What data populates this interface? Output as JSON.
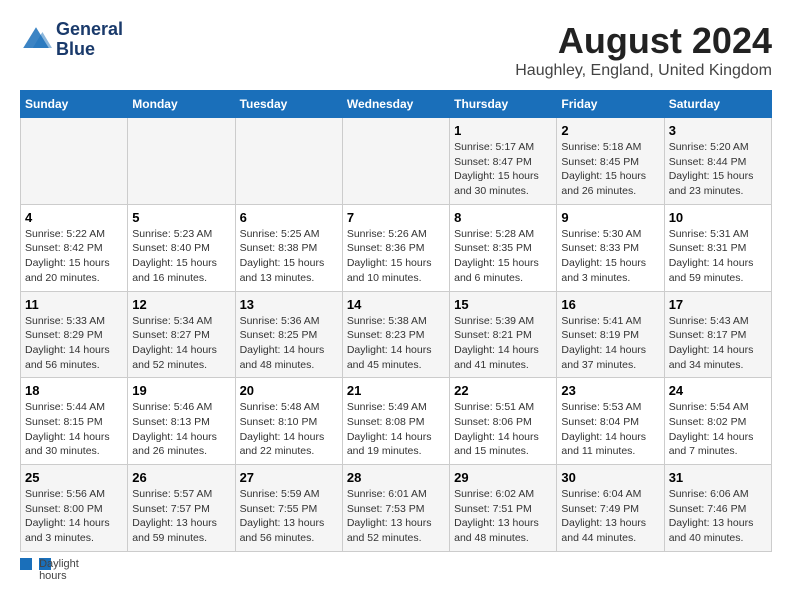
{
  "header": {
    "logo_line1": "General",
    "logo_line2": "Blue",
    "main_title": "August 2024",
    "subtitle": "Haughley, England, United Kingdom"
  },
  "days_of_week": [
    "Sunday",
    "Monday",
    "Tuesday",
    "Wednesday",
    "Thursday",
    "Friday",
    "Saturday"
  ],
  "weeks": [
    [
      {
        "day": "",
        "info": ""
      },
      {
        "day": "",
        "info": ""
      },
      {
        "day": "",
        "info": ""
      },
      {
        "day": "",
        "info": ""
      },
      {
        "day": "1",
        "info": "Sunrise: 5:17 AM\nSunset: 8:47 PM\nDaylight: 15 hours\nand 30 minutes."
      },
      {
        "day": "2",
        "info": "Sunrise: 5:18 AM\nSunset: 8:45 PM\nDaylight: 15 hours\nand 26 minutes."
      },
      {
        "day": "3",
        "info": "Sunrise: 5:20 AM\nSunset: 8:44 PM\nDaylight: 15 hours\nand 23 minutes."
      }
    ],
    [
      {
        "day": "4",
        "info": "Sunrise: 5:22 AM\nSunset: 8:42 PM\nDaylight: 15 hours\nand 20 minutes."
      },
      {
        "day": "5",
        "info": "Sunrise: 5:23 AM\nSunset: 8:40 PM\nDaylight: 15 hours\nand 16 minutes."
      },
      {
        "day": "6",
        "info": "Sunrise: 5:25 AM\nSunset: 8:38 PM\nDaylight: 15 hours\nand 13 minutes."
      },
      {
        "day": "7",
        "info": "Sunrise: 5:26 AM\nSunset: 8:36 PM\nDaylight: 15 hours\nand 10 minutes."
      },
      {
        "day": "8",
        "info": "Sunrise: 5:28 AM\nSunset: 8:35 PM\nDaylight: 15 hours\nand 6 minutes."
      },
      {
        "day": "9",
        "info": "Sunrise: 5:30 AM\nSunset: 8:33 PM\nDaylight: 15 hours\nand 3 minutes."
      },
      {
        "day": "10",
        "info": "Sunrise: 5:31 AM\nSunset: 8:31 PM\nDaylight: 14 hours\nand 59 minutes."
      }
    ],
    [
      {
        "day": "11",
        "info": "Sunrise: 5:33 AM\nSunset: 8:29 PM\nDaylight: 14 hours\nand 56 minutes."
      },
      {
        "day": "12",
        "info": "Sunrise: 5:34 AM\nSunset: 8:27 PM\nDaylight: 14 hours\nand 52 minutes."
      },
      {
        "day": "13",
        "info": "Sunrise: 5:36 AM\nSunset: 8:25 PM\nDaylight: 14 hours\nand 48 minutes."
      },
      {
        "day": "14",
        "info": "Sunrise: 5:38 AM\nSunset: 8:23 PM\nDaylight: 14 hours\nand 45 minutes."
      },
      {
        "day": "15",
        "info": "Sunrise: 5:39 AM\nSunset: 8:21 PM\nDaylight: 14 hours\nand 41 minutes."
      },
      {
        "day": "16",
        "info": "Sunrise: 5:41 AM\nSunset: 8:19 PM\nDaylight: 14 hours\nand 37 minutes."
      },
      {
        "day": "17",
        "info": "Sunrise: 5:43 AM\nSunset: 8:17 PM\nDaylight: 14 hours\nand 34 minutes."
      }
    ],
    [
      {
        "day": "18",
        "info": "Sunrise: 5:44 AM\nSunset: 8:15 PM\nDaylight: 14 hours\nand 30 minutes."
      },
      {
        "day": "19",
        "info": "Sunrise: 5:46 AM\nSunset: 8:13 PM\nDaylight: 14 hours\nand 26 minutes."
      },
      {
        "day": "20",
        "info": "Sunrise: 5:48 AM\nSunset: 8:10 PM\nDaylight: 14 hours\nand 22 minutes."
      },
      {
        "day": "21",
        "info": "Sunrise: 5:49 AM\nSunset: 8:08 PM\nDaylight: 14 hours\nand 19 minutes."
      },
      {
        "day": "22",
        "info": "Sunrise: 5:51 AM\nSunset: 8:06 PM\nDaylight: 14 hours\nand 15 minutes."
      },
      {
        "day": "23",
        "info": "Sunrise: 5:53 AM\nSunset: 8:04 PM\nDaylight: 14 hours\nand 11 minutes."
      },
      {
        "day": "24",
        "info": "Sunrise: 5:54 AM\nSunset: 8:02 PM\nDaylight: 14 hours\nand 7 minutes."
      }
    ],
    [
      {
        "day": "25",
        "info": "Sunrise: 5:56 AM\nSunset: 8:00 PM\nDaylight: 14 hours\nand 3 minutes."
      },
      {
        "day": "26",
        "info": "Sunrise: 5:57 AM\nSunset: 7:57 PM\nDaylight: 13 hours\nand 59 minutes."
      },
      {
        "day": "27",
        "info": "Sunrise: 5:59 AM\nSunset: 7:55 PM\nDaylight: 13 hours\nand 56 minutes."
      },
      {
        "day": "28",
        "info": "Sunrise: 6:01 AM\nSunset: 7:53 PM\nDaylight: 13 hours\nand 52 minutes."
      },
      {
        "day": "29",
        "info": "Sunrise: 6:02 AM\nSunset: 7:51 PM\nDaylight: 13 hours\nand 48 minutes."
      },
      {
        "day": "30",
        "info": "Sunrise: 6:04 AM\nSunset: 7:49 PM\nDaylight: 13 hours\nand 44 minutes."
      },
      {
        "day": "31",
        "info": "Sunrise: 6:06 AM\nSunset: 7:46 PM\nDaylight: 13 hours\nand 40 minutes."
      }
    ]
  ],
  "footer": {
    "note_label": "Daylight hours"
  }
}
